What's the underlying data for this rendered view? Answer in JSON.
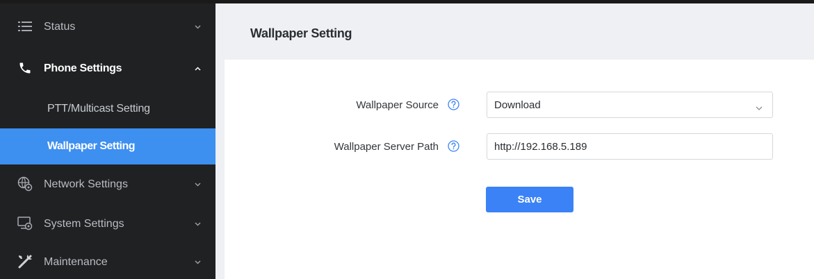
{
  "sidebar": {
    "items": [
      {
        "label": "Status",
        "icon": "list-icon"
      },
      {
        "label": "Phone Settings",
        "icon": "phone-icon"
      },
      {
        "label": "Network Settings",
        "icon": "network-icon"
      },
      {
        "label": "System Settings",
        "icon": "system-settings-icon"
      },
      {
        "label": "Maintenance",
        "icon": "tools-icon"
      }
    ],
    "subitems": [
      {
        "label": "PTT/Multicast Setting"
      },
      {
        "label": "Wallpaper Setting"
      }
    ]
  },
  "main": {
    "title": "Wallpaper Setting",
    "form": {
      "source_label": "Wallpaper Source",
      "source_value": "Download",
      "path_label": "Wallpaper Server Path",
      "path_value": "http://192.168.5.189",
      "save_label": "Save"
    }
  },
  "colors": {
    "sidebar_bg": "#1f2123",
    "active_item": "#3d8ff0",
    "accent": "#3b82f6",
    "main_bg": "#eef0f3"
  }
}
